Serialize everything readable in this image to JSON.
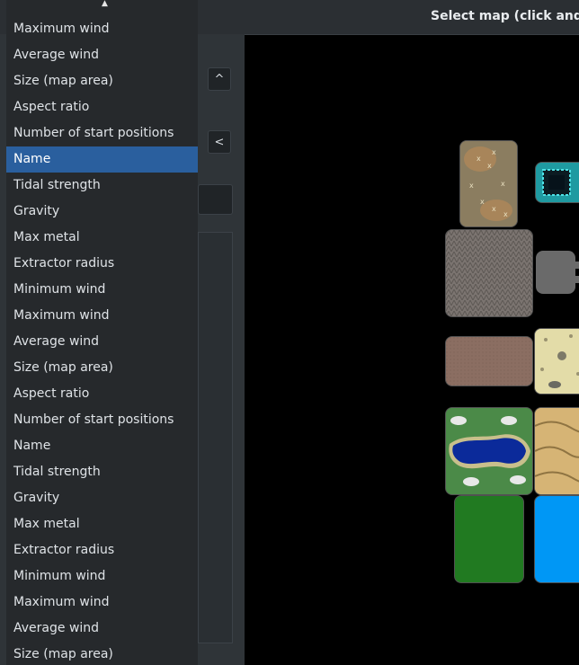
{
  "header": {
    "title": "Select map (click and d"
  },
  "panel": {
    "up_button": "^",
    "back_button": "<"
  },
  "dropdown": {
    "scroll_indicator": "▲",
    "items": [
      "Maximum wind",
      "Average wind",
      "Size (map area)",
      "Aspect ratio",
      "Number of start positions",
      "Name",
      "Tidal strength",
      "Gravity",
      "Max metal",
      "Extractor radius",
      "Minimum wind",
      "Maximum wind",
      "Average wind",
      "Size (map area)",
      "Aspect ratio",
      "Number of start positions",
      "Name",
      "Tidal strength",
      "Gravity",
      "Max metal",
      "Extractor radius",
      "Minimum wind",
      "Maximum wind",
      "Average wind",
      "Size (map area)"
    ],
    "selected_index": 5
  },
  "colors": {
    "selected_bg": "#2a5f9e",
    "dropdown_bg": "#26292c",
    "panel_bg": "#2f3438",
    "header_bg": "#2b2f33"
  },
  "maps": [
    {
      "name": "desert-rocky-map",
      "style": "desert-rocks"
    },
    {
      "name": "teal-circuit-map",
      "style": "circuit"
    },
    {
      "name": "gray-metal-map",
      "style": "metal"
    },
    {
      "name": "gray-blocks-map",
      "style": "gray-blocks"
    },
    {
      "name": "brown-flat-map",
      "style": "brown"
    },
    {
      "name": "sand-spots-map",
      "style": "sand"
    },
    {
      "name": "lake-map",
      "style": "lake"
    },
    {
      "name": "dunes-map",
      "style": "dunes"
    },
    {
      "name": "green-flat-map",
      "style": "green"
    },
    {
      "name": "blue-water-map",
      "style": "blue"
    }
  ]
}
